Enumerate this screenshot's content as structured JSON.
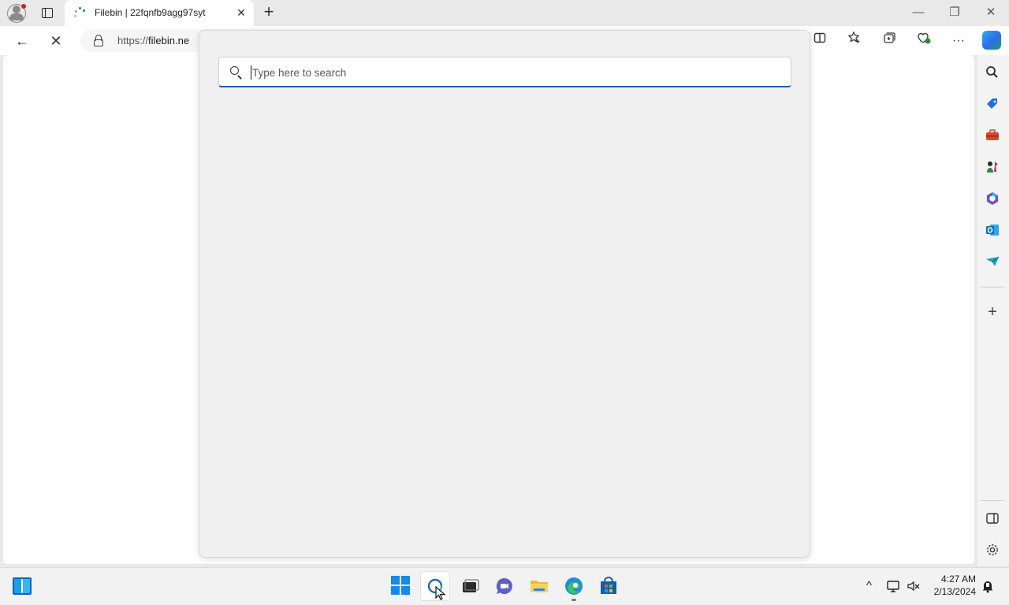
{
  "browser": {
    "tab": {
      "title": "Filebin | 22fqnfb9agg97syt",
      "close_glyph": "✕"
    },
    "new_tab_glyph": "+",
    "window_controls": {
      "minimize": "—",
      "restore": "❐",
      "close": "✕"
    },
    "nav": {
      "back_glyph": "←",
      "stop_glyph": "✕"
    },
    "address": {
      "scheme": "https://",
      "host": "filebin.ne"
    },
    "toolbar": {
      "split_screen_icon": "split-screen-icon",
      "favorites_icon": "favorites-icon",
      "collections_icon": "collections-icon",
      "browser_essentials_icon": "browser-essentials-icon",
      "more_glyph": "···",
      "copilot_icon": "copilot-icon"
    }
  },
  "sidebar": {
    "items": [
      "search",
      "shopping",
      "tools",
      "games",
      "microsoft-365",
      "outlook",
      "drop"
    ],
    "add_glyph": "+",
    "colors": {
      "search": "#2b2b2b",
      "shopping": "#1f6fe0",
      "tools": "#d9472b",
      "games": "#2b8a3e",
      "microsoft-365": "#6b4fd1",
      "outlook": "#0f6cbd",
      "drop": "#17a2b8"
    }
  },
  "search_flyout": {
    "placeholder": "Type here to search",
    "value": ""
  },
  "taskbar": {
    "apps": [
      "start",
      "search",
      "task-view",
      "teams-chat",
      "file-explorer",
      "edge",
      "store"
    ],
    "tray_chevron": "^",
    "clock": {
      "time": "4:27 AM",
      "date": "2/13/2024"
    },
    "colors": {
      "accent": "#1789e6"
    }
  }
}
